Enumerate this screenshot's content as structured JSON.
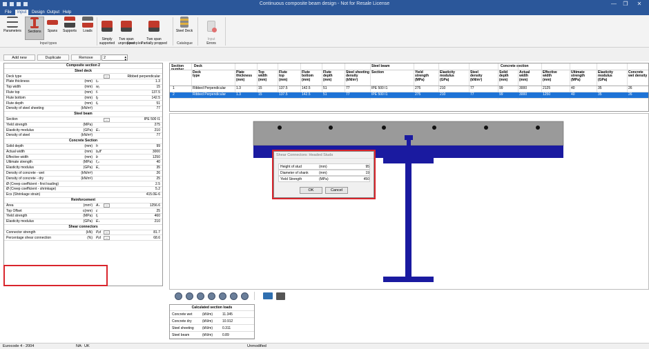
{
  "window": {
    "title": "Continuous composite beam design - Not for Resale License",
    "controls": [
      "—",
      "❐",
      "✕"
    ]
  },
  "menu": [
    "File",
    "Input",
    "Design",
    "Output",
    "Help"
  ],
  "ribbon": {
    "buttons": [
      {
        "label": "Parameters"
      },
      {
        "label": "Sections"
      },
      {
        "label": "Spans"
      },
      {
        "label": "Supports"
      },
      {
        "label": "Loads"
      },
      {
        "label": "Simply\nsupported"
      },
      {
        "label": "Two span\nunpropped"
      },
      {
        "label": "Two span\nPartially propped"
      },
      {
        "label": "Steel Deck"
      },
      {
        "label": "Input\nErrors"
      }
    ],
    "groups": [
      "Input types",
      "Examples",
      "Catalogue",
      "Errors"
    ]
  },
  "toolbar": {
    "add_new": "Add new",
    "duplicate": "Duplicate",
    "remove": "Remove",
    "spin_value": "2"
  },
  "section_panel": {
    "title": "Composite section 2",
    "rows": [
      {
        "type": "hdr",
        "label": "Steel deck"
      },
      {
        "label": "Deck type",
        "unit": "",
        "sym": "",
        "btn": true,
        "value": "Ribbed perpendicular"
      },
      {
        "label": "Plate thickness",
        "unit": "(mm)",
        "sym": "tₚ",
        "value": "1.3"
      },
      {
        "label": "Top width",
        "unit": "(mm)",
        "sym": "w₁",
        "value": "15"
      },
      {
        "label": "Flute top",
        "unit": "(mm)",
        "sym": "fₜ",
        "value": "137.5"
      },
      {
        "label": "Flute bottom",
        "unit": "(mm)",
        "sym": "fᵦ",
        "value": "142.5"
      },
      {
        "label": "Flute depth",
        "unit": "(mm)",
        "sym": "fₑ",
        "value": "51"
      },
      {
        "label": "Density of steel sheeting",
        "unit": "(kN/m³)",
        "sym": "",
        "value": "77"
      },
      {
        "type": "hdr",
        "label": "Steel beam"
      },
      {
        "label": "Section",
        "unit": "",
        "sym": "",
        "btn": true,
        "value": "IPE 500   I1"
      },
      {
        "label": "Yield strength",
        "unit": "(MPa)",
        "sym": "",
        "value": "275"
      },
      {
        "label": "Elasticity modulus",
        "unit": "(GPa)",
        "sym": "Eₛ",
        "value": "210"
      },
      {
        "label": "Density of steel",
        "unit": "(kN/m³)",
        "sym": "",
        "value": "77"
      },
      {
        "type": "hdr",
        "label": "Concrete Section"
      },
      {
        "label": "Solid depth",
        "unit": "(mm)",
        "sym": "h",
        "value": "99"
      },
      {
        "label": "Actual width",
        "unit": "(mm)",
        "sym": "bₑff",
        "value": "3000"
      },
      {
        "label": "Effective width",
        "unit": "(mm)",
        "sym": "b",
        "value": "1250"
      },
      {
        "label": "Ultimate strength",
        "unit": "(MPa)",
        "sym": "f꜀ₖ",
        "value": "40"
      },
      {
        "label": "Elasticity modulus",
        "unit": "(GPa)",
        "sym": "E꜀",
        "value": "35"
      },
      {
        "label": "Density of concrete - wet",
        "unit": "(kN/m³)",
        "sym": "",
        "value": "26"
      },
      {
        "label": "Density of concrete - dry",
        "unit": "(kN/m³)",
        "sym": "",
        "value": "25"
      },
      {
        "label": "Ø (Creep coefficient - first loading)",
        "unit": "",
        "sym": "",
        "value": "2.5"
      },
      {
        "label": "Ø (Creep coefficient - shrinkage)",
        "unit": "",
        "sym": "",
        "value": "5.2"
      },
      {
        "label": "Ecs (Shrinkage strain)",
        "unit": "",
        "sym": "",
        "value": "415.0E-6"
      },
      {
        "type": "hdr",
        "label": "Reinforcement"
      },
      {
        "label": "Area",
        "unit": "(mm²)",
        "sym": "Aₛ",
        "btn": true,
        "value": "1256.6"
      },
      {
        "label": "Top Offset",
        "unit": "c(mm)",
        "sym": "c",
        "value": "25"
      },
      {
        "label": "Yield strength",
        "unit": "(MPa)",
        "sym": "fᵧ",
        "value": "460"
      },
      {
        "label": "Elasticity modulus",
        "unit": "(GPa)",
        "sym": "Eₛ",
        "value": "210"
      },
      {
        "type": "hdr",
        "label": "Shear connectors"
      },
      {
        "label": "Connector strength",
        "unit": "(kN)",
        "sym": "Pᵣd",
        "btn": true,
        "value": "81.7"
      },
      {
        "label": "Percentage shear connection",
        "unit": "(%)",
        "sym": "Pᵣd",
        "btn": true,
        "value": "68.6"
      }
    ]
  },
  "sections_table": {
    "group_headers": [
      "Section\nnumber",
      "Deck",
      "Steel beam",
      "Concrete section"
    ],
    "columns": [
      "Deck\ntype",
      "Plate\nthickness\n(mm)",
      "Top\nwidth\n(mm)",
      "Flute\ntop\n(mm)",
      "Flute\nbottom\n(mm)",
      "Flute\ndepth\n(mm)",
      "Steel sheeting\ndensity\n(kN/m³)",
      "Section",
      "Yield\nstrength\n(MPa)",
      "Elasticity\nmodulus\n(GPa)",
      "Steel\ndensity\n(kN/m³)",
      "Solid\ndepth\n(mm)",
      "Actual\nwidth\n(mm)",
      "Effective\nwidth\n(mm)",
      "Ultimate\nstrength\n(MPa)",
      "Elasticity\nmodulus\n(GPa)",
      "Concrete\nwet density"
    ],
    "rows": [
      {
        "num": "1",
        "cells": [
          "Ribbed Perpendicular",
          "1.3",
          "15",
          "137.5",
          "142.5",
          "51",
          "77",
          "IPE 500    I1",
          "275",
          "210",
          "77",
          "99",
          "3000",
          "2125",
          "40",
          "35",
          "26"
        ]
      },
      {
        "num": "2",
        "cells": [
          "Ribbed Perpendicular",
          "1.3",
          "15",
          "137.5",
          "142.5",
          "51",
          "77",
          "IPE 500    I1",
          "275",
          "210",
          "77",
          "99",
          "3000",
          "1250",
          "40",
          "35",
          "26"
        ]
      }
    ]
  },
  "dialog": {
    "title": "Shear Connectors: Headed Studs",
    "rows": [
      {
        "label": "Height of stud",
        "unit": "(mm)",
        "value": "95"
      },
      {
        "label": "Diameter of shank",
        "unit": "(mm)",
        "value": "19"
      },
      {
        "label": "Yield Strength",
        "unit": "(MPa)",
        "value": "450"
      }
    ],
    "ok": "OK",
    "cancel": "Cancel"
  },
  "loads_panel": {
    "title": "Calculated section loads",
    "rows": [
      {
        "label": "Concrete wet",
        "unit": "(kN/m)",
        "value": "11.345"
      },
      {
        "label": "Concrete dry",
        "unit": "(kN/m)",
        "value": "10.912"
      },
      {
        "label": "Steel sheeting",
        "unit": "(kN/m)",
        "value": "0.311"
      },
      {
        "label": "Steel beam",
        "unit": "(kN/m)",
        "value": "0.89"
      }
    ]
  },
  "status": {
    "code": "Eurocode 4 - 2004",
    "na_label": "NA:",
    "na_value": "UK",
    "state": "Unmodified"
  },
  "colors": {
    "title_bar": "#2b579a",
    "selection": "#1e73d6",
    "beam": "#1a1aa0",
    "slab": "#9a9a9a",
    "highlight": "#d9242b"
  }
}
